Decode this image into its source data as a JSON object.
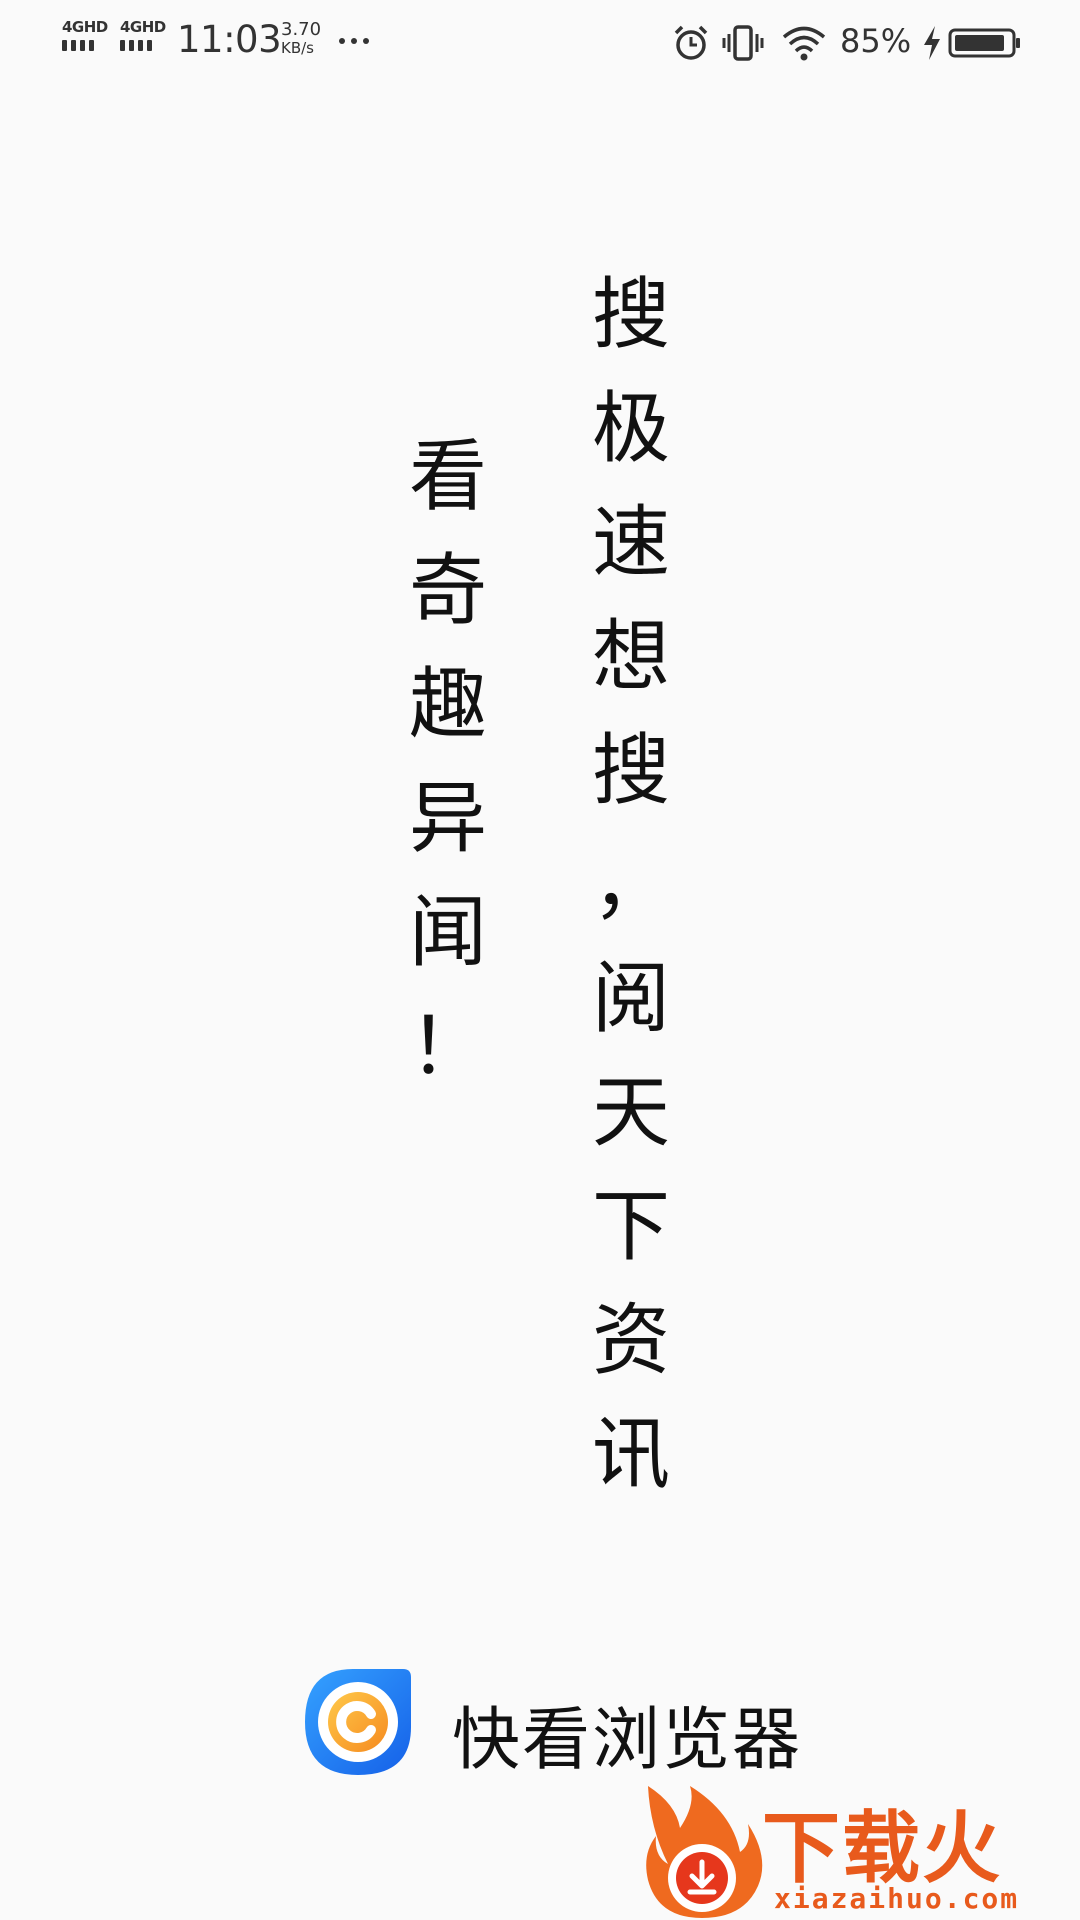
{
  "status_bar": {
    "sim1_label": "4GHD",
    "sim2_label": "4GHD",
    "time": "11:03",
    "net_speed_value": "3.70",
    "net_speed_unit": "KB/s",
    "battery_percent": "85%",
    "icons": [
      "signal-icon",
      "signal-icon",
      "more-icon",
      "alarm-icon",
      "vibrate-icon",
      "wifi-icon",
      "charging-icon",
      "battery-icon"
    ]
  },
  "slogan": {
    "right_column": [
      "搜",
      "极",
      "速",
      "想",
      "搜",
      "，",
      "阅",
      "天",
      "下",
      "资",
      "讯"
    ],
    "left_column": [
      "看",
      "奇",
      "趣",
      "异",
      "闻",
      "！"
    ]
  },
  "brand": {
    "name": "快看浏览器",
    "logo_icon": "app-logo-icon",
    "colors": {
      "blue": "#1a73f0",
      "orange": "#f5a623"
    }
  },
  "watermark": {
    "text": "下载火",
    "site": "xiazaihuo.com",
    "logo_icon": "flame-logo-icon",
    "color": "#e85a1c"
  }
}
